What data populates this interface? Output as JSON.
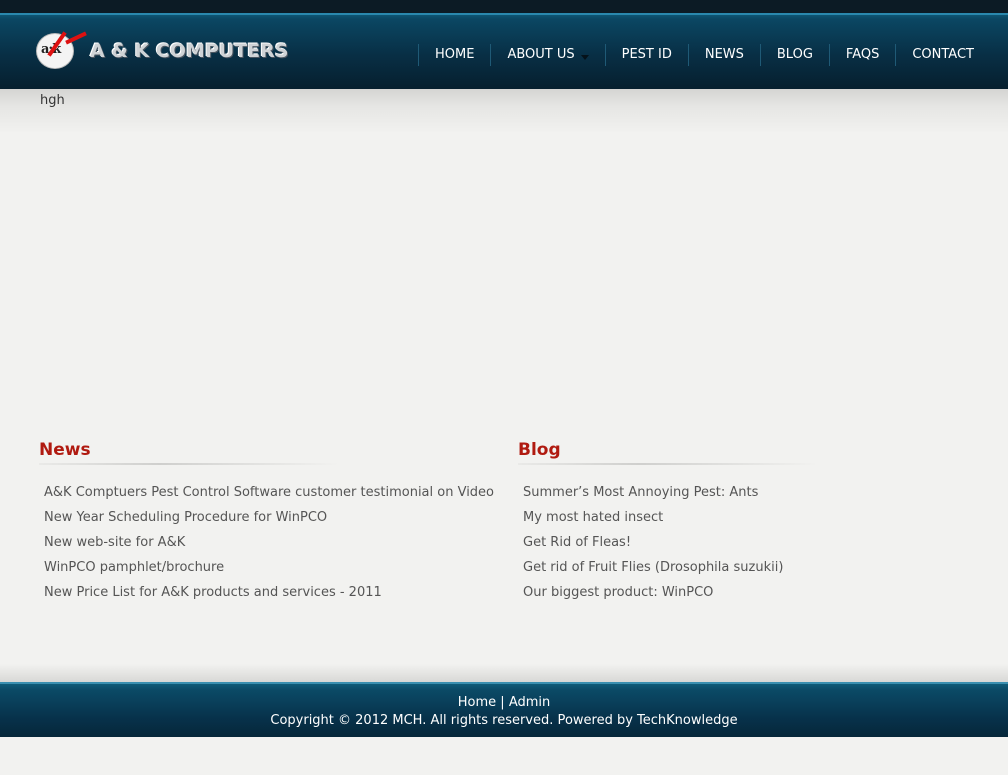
{
  "header": {
    "logo_title": "A & K COMPUTERS",
    "logo_mark": "a:k",
    "nav": [
      {
        "label": "HOME"
      },
      {
        "label": "ABOUT US",
        "has_dropdown": true
      },
      {
        "label": "PEST ID"
      },
      {
        "label": "NEWS"
      },
      {
        "label": "BLOG"
      },
      {
        "label": "FAQS"
      },
      {
        "label": "CONTACT"
      }
    ]
  },
  "banner": {
    "text": "hgh"
  },
  "news": {
    "heading": "News",
    "items": [
      "A&K Comptuers Pest Control Software customer testimonial on Video",
      "New Year Scheduling Procedure for WinPCO",
      "New web-site for A&K",
      "WinPCO pamphlet/brochure",
      "New Price List for A&K products and services - 2011"
    ]
  },
  "blog": {
    "heading": "Blog",
    "items": [
      "Summer’s Most Annoying Pest: Ants",
      "My most hated insect",
      "Get Rid of Fleas!",
      "Get rid of Fruit Flies (Drosophila suzukii)",
      "Our biggest product: WinPCO"
    ]
  },
  "footer": {
    "link_home": "Home",
    "separator": "|",
    "link_admin": "Admin",
    "copyright": "Copyright © 2012 MCH. All rights reserved. Powered by TechKnowledge"
  },
  "colors": {
    "header_bg": "#082f45",
    "heading_red": "#b01a10",
    "page_bg": "#f2f2f0"
  }
}
